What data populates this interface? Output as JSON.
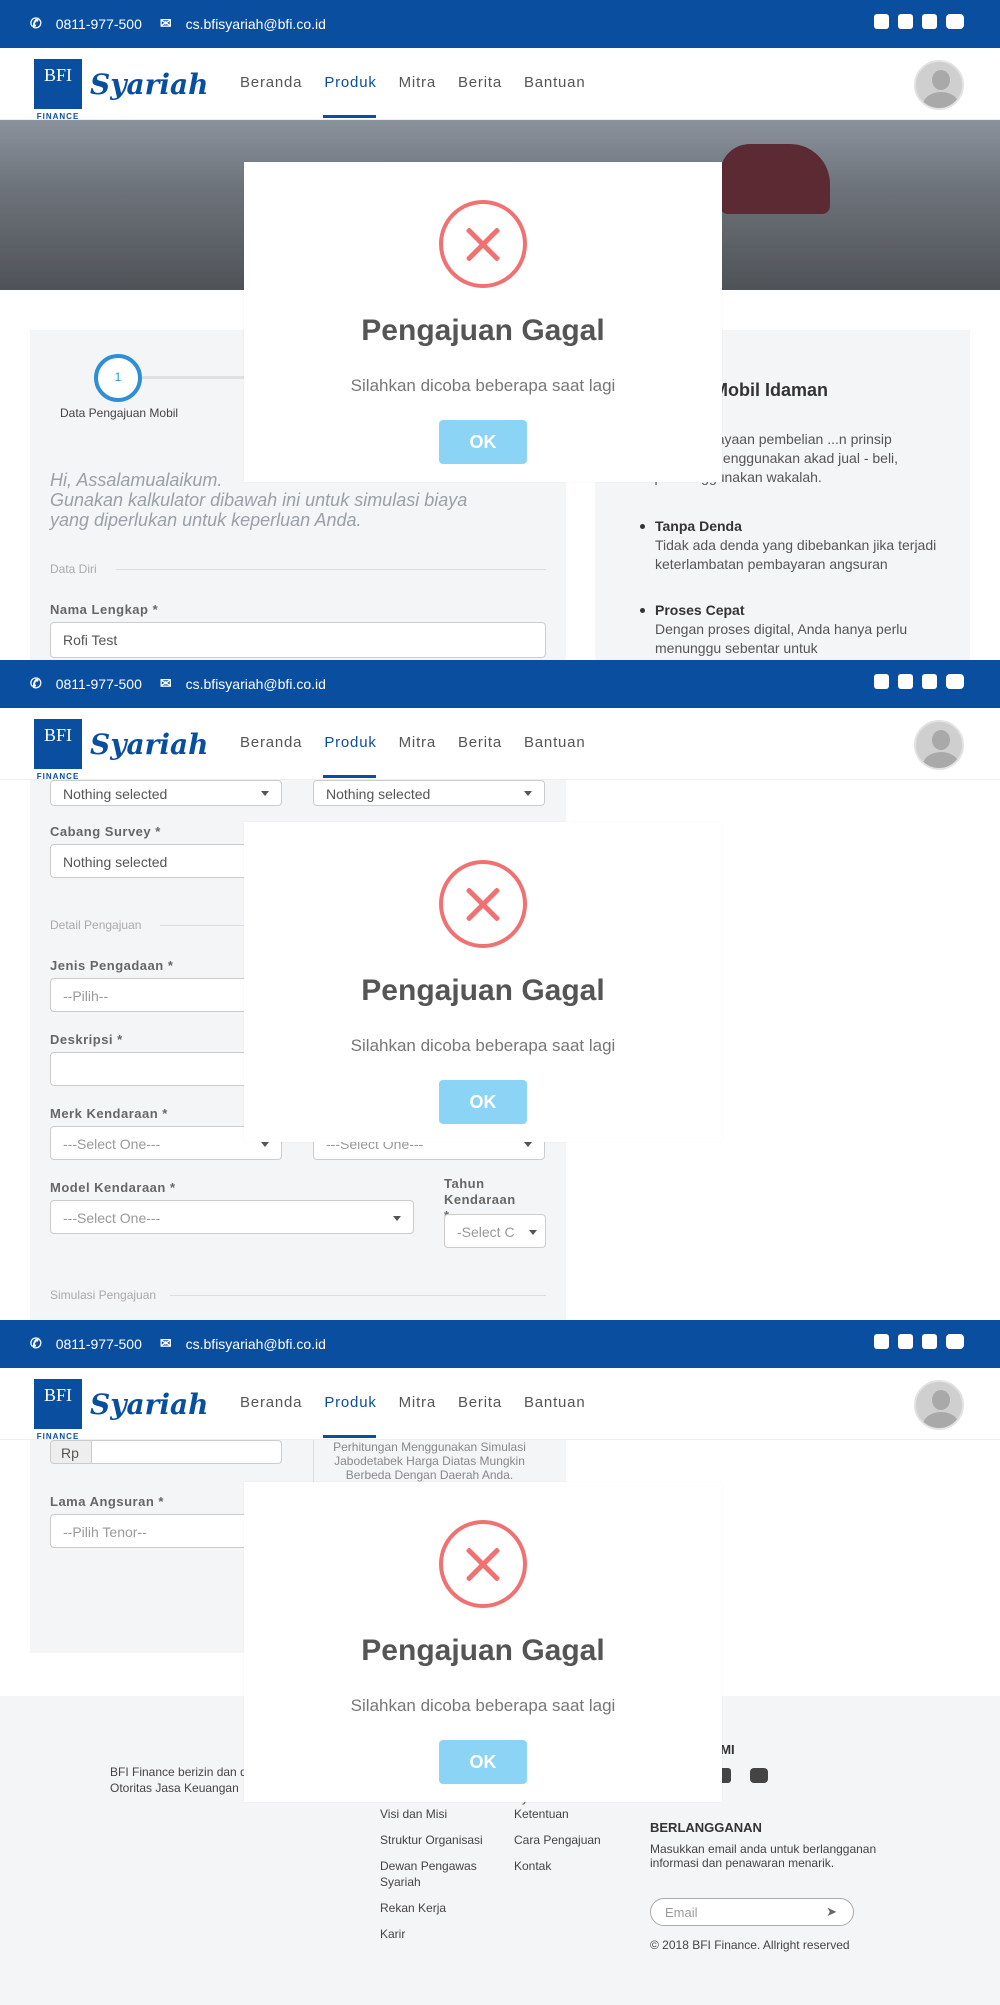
{
  "topbar": {
    "phone": "0811-977-500",
    "email": "cs.bfisyariah@bfi.co.id"
  },
  "logo": {
    "bfi": "BFI",
    "finance": "FINANCE",
    "syariah": "Syariah"
  },
  "nav": {
    "items": [
      "Beranda",
      "Produk",
      "Mitra",
      "Berita",
      "Bantuan"
    ],
    "active": "Produk"
  },
  "modal": {
    "title": "Pengajuan Gagal",
    "message": "Silahkan dicoba beberapa saat lagi",
    "ok": "OK"
  },
  "colors": {
    "brand": "#0a4ea0",
    "error": "#f07171",
    "ok_button": "#8cd4f5"
  },
  "step": {
    "number": "1",
    "label": "Data Pengajuan Mobil"
  },
  "greeting": "Hi, Assalamualaikum.",
  "greeting_sub": "Gunakan kalkulator dibawah ini untuk simulasi biaya yang diperlukan untuk keperluan Anda.",
  "sections": {
    "data_diri": "Data Diri",
    "detail_pengajuan": "Detail Pengajuan",
    "simulasi": "Simulasi Pengajuan"
  },
  "fields": {
    "nama_label": "Nama Lengkap *",
    "nama_value": "Rofi Test",
    "nothing_selected": "Nothing selected",
    "cabang_label": "Cabang Survey *",
    "jenis_label": "Jenis Pengadaan *",
    "jenis_value": "--Pilih--",
    "deskripsi_label": "Deskripsi *",
    "merk_label": "Merk Kendaraan *",
    "select_one": "---Select One---",
    "model_label": "Model Kendaraan *",
    "tahun_label": "Tahun Kendaraan *",
    "tahun_value": "-Select C",
    "rp": "Rp",
    "lama_label": "Lama Angsuran *",
    "lama_value": "--Pilih Tenor--",
    "note": "Perhitungan Menggunakan Simulasi Jabodetabek Harga Diatas Mungkin Berbeda Dengan Daerah Anda."
  },
  "right": {
    "title": "...gera Mobil Idaman",
    "intro": "...alah Pembiayaan pembelian ...n prinsip syariah dan menggunakan akad jual - beli, tanpa menggunakan wakalah.",
    "b1_title": "Tanpa Denda",
    "b1_text": "Tidak ada denda yang dibebankan jika terjadi keterlambatan pembayaran angsuran",
    "b2_title": "Proses Cepat",
    "b2_text": "Dengan proses digital, Anda hanya perlu menunggu sebentar untuk"
  },
  "footer": {
    "izin": "BFI Finance berizin dan diawasi oleh Otoritas Jasa Keuangan",
    "links1": [
      "Visi dan Misi",
      "Struktur Organisasi",
      "Dewan Pengawas Syariah",
      "Rekan Kerja",
      "Karir"
    ],
    "links2": [
      "Syarat dan Ketentuan",
      "Cara Pengajuan",
      "Kontak"
    ],
    "follow": "...AMI",
    "subscribe_title": "BERLANGGANAN",
    "subscribe_text": "Masukkan email anda untuk berlangganan informasi dan penawaran menarik.",
    "email_placeholder": "Email",
    "copyright": "© 2018 BFI Finance. Allright reserved"
  }
}
